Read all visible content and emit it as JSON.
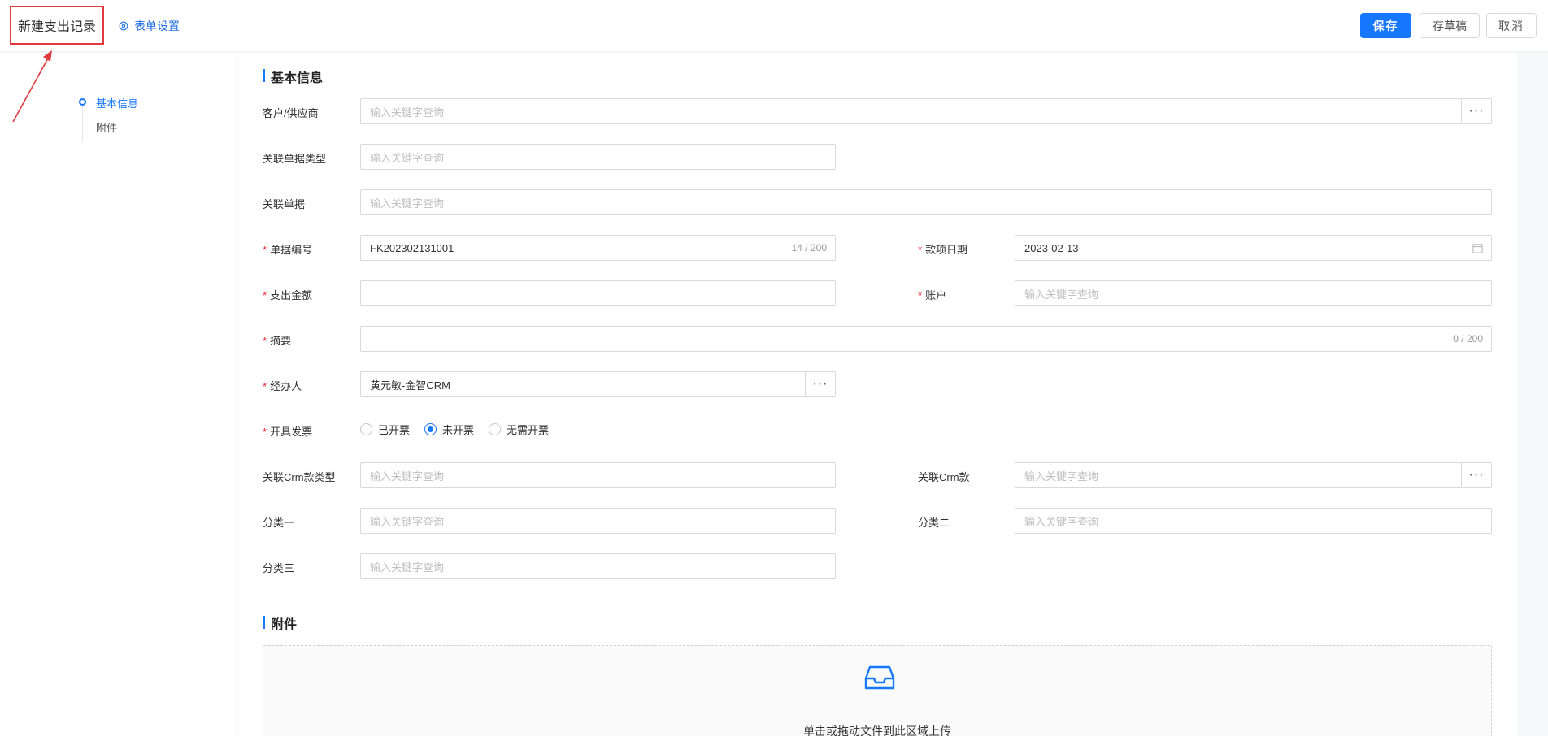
{
  "header": {
    "title": "新建支出记录",
    "form_settings": "表单设置",
    "save": "保存",
    "draft": "存草稿",
    "cancel": "取消"
  },
  "nav": {
    "items": [
      {
        "label": "基本信息",
        "active": true
      },
      {
        "label": "附件",
        "active": false
      }
    ]
  },
  "sections": {
    "basic": "基本信息",
    "attachment": "附件"
  },
  "fields": {
    "customer": {
      "label": "客户/供应商",
      "placeholder": "输入关键字查询"
    },
    "related_doc_type": {
      "label": "关联单据类型",
      "placeholder": "输入关键字查询"
    },
    "related_doc": {
      "label": "关联单据",
      "placeholder": "输入关键字查询"
    },
    "doc_no": {
      "label": "单据编号",
      "value": "FK202302131001",
      "count": "14 / 200"
    },
    "date": {
      "label": "款项日期",
      "value": "2023-02-13"
    },
    "amount": {
      "label": "支出金额",
      "value": ""
    },
    "account": {
      "label": "账户",
      "placeholder": "输入关键字查询"
    },
    "summary": {
      "label": "摘要",
      "value": "",
      "count": "0 / 200"
    },
    "handler": {
      "label": "经办人",
      "value": "黄元敏-金智CRM"
    },
    "invoice": {
      "label": "开具发票",
      "options": [
        "已开票",
        "未开票",
        "无需开票"
      ],
      "selected": "未开票"
    },
    "crm_type": {
      "label": "关联Crm款类型",
      "placeholder": "输入关键字查询"
    },
    "crm": {
      "label": "关联Crm款",
      "placeholder": "输入关键字查询"
    },
    "cat1": {
      "label": "分类一",
      "placeholder": "输入关键字查询"
    },
    "cat2": {
      "label": "分类二",
      "placeholder": "输入关键字查询"
    },
    "cat3": {
      "label": "分类三",
      "placeholder": "输入关键字查询"
    }
  },
  "upload": {
    "text": "单击或拖动文件到此区域上传"
  },
  "colors": {
    "primary": "#1677ff",
    "required": "#f5222d",
    "annotation": "#e0393e"
  }
}
